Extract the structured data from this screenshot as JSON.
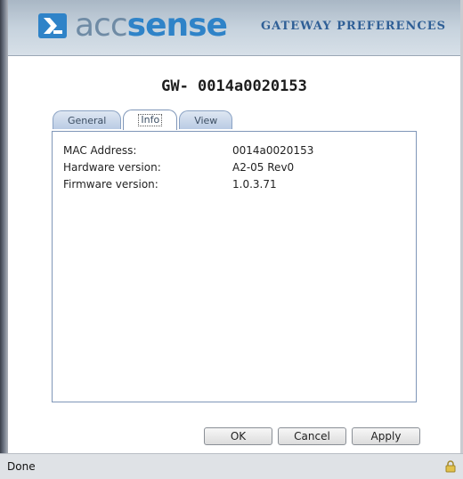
{
  "header": {
    "logo_acc": "acc",
    "logo_sense": "sense",
    "title": "GATEWAY PREFERENCES"
  },
  "gateway_title": "GW- 0014a0020153",
  "tabs": [
    {
      "label": "General",
      "active": false
    },
    {
      "label": "Info",
      "active": true
    },
    {
      "label": "View",
      "active": false
    }
  ],
  "info": {
    "rows": [
      {
        "label": "MAC Address:",
        "value": "0014a0020153"
      },
      {
        "label": "Hardware version:",
        "value": "A2-05 Rev0"
      },
      {
        "label": "Firmware version:",
        "value": "1.0.3.71"
      }
    ]
  },
  "buttons": {
    "ok": "OK",
    "cancel": "Cancel",
    "apply": "Apply"
  },
  "status": {
    "text": "Done",
    "icon": "lock-icon"
  },
  "colors": {
    "brand_blue": "#2f83c8",
    "brand_gray": "#6f8ba5",
    "header_title": "#2f5f96",
    "tab_border": "#7f96b8"
  }
}
